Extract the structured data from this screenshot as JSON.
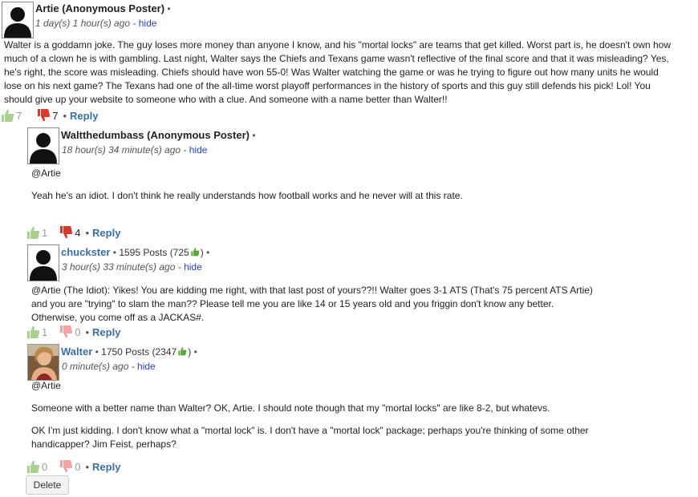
{
  "comments": [
    {
      "author": "Artie (Anonymous Poster)",
      "time": "1 day(s) 1 hour(s) ago",
      "hide": "hide",
      "body": [
        "Walter is a goddamn joke. The guy loses more money than anyone I know, and his \"mortal locks\" are teams that get killed. Worst part is, he doesn't own how much of a clown he is with gambling. Last night, Walter says the Chiefs and Texans game wasn't reflective of the final score and that it was misleading? Yes, he's right, the score was misleading. Chiefs should have won 55-0! Was Walter watching the game or was he trying to figure out how many units he would lose on his next game? The Texans had one of the all-time worst playoff performances in the history of sports and this guy still defends his pick! Lol! You should give up your website to someone who with a clue. And someone with a name better than Walter!!"
      ],
      "up": "7",
      "down": "7",
      "reply": "Reply"
    },
    {
      "author": "Waltthedumbass (Anonymous Poster)",
      "time": "18 hour(s) 34 minute(s) ago",
      "hide": "hide",
      "body": [
        "@Artie",
        "Yeah he's an idiot. I don't think he really understands how football works and he never will at this rate."
      ],
      "up": "1",
      "down": "4",
      "reply": "Reply"
    },
    {
      "author": "chuckster",
      "posts": "1595 Posts (725",
      "posts_close": ")",
      "time": "3 hour(s) 33 minute(s) ago",
      "hide": "hide",
      "body": [
        "@Artie (The Idiot):  Yikes!  You are kidding me right,  with that last post of yours??!!  Walter goes 3-1 ATS  (That's 75 percent ATS Artie)",
        "and you are \"trying\" to slam the man??  Please tell me you are like 14 or 15 years old and  you friggin don't know any better.",
        "Otherwise,  you come off as a  JACKAS#."
      ],
      "up": "1",
      "down": "0",
      "reply": "Reply"
    },
    {
      "author": "Walter",
      "posts": "1750 Posts (2347",
      "posts_close": ")",
      "time": "0 minute(s) ago",
      "hide": "hide",
      "body": [
        "@Artie",
        "Someone with a better name than Walter? OK, Artie. I should note though that my \"mortal locks\" are like 8-2, but whatevs.",
        "OK I'm just kidding. I don't know what a \"mortal lock\" is. I don't have a \"mortal lock\" package; perhaps you're thinking of some other handicapper? Jim Feist, perhaps?"
      ],
      "up": "0",
      "down": "0",
      "reply": "Reply",
      "delete": "Delete"
    }
  ],
  "separators": {
    "dot": "•"
  },
  "colors": {
    "link": "#3a6ea5",
    "hide": "#2a44b5",
    "thumb_up": "#7bbf5a",
    "thumb_down_active": "#d83a2a",
    "thumb_down_inactive": "#f0a3a3"
  }
}
